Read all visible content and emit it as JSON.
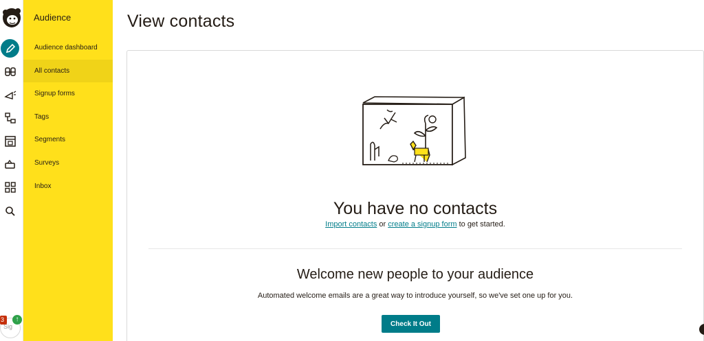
{
  "sidebar": {
    "title": "Audience",
    "items": [
      {
        "label": "Audience dashboard"
      },
      {
        "label": "All contacts"
      },
      {
        "label": "Signup forms"
      },
      {
        "label": "Tags"
      },
      {
        "label": "Segments"
      },
      {
        "label": "Surveys"
      },
      {
        "label": "Inbox"
      }
    ],
    "active_item": "All contacts"
  },
  "rail": {
    "icons": [
      "freddie-logo",
      "create-pencil-icon",
      "audience-icon",
      "campaigns-icon",
      "automations-icon",
      "website-icon",
      "content-icon",
      "integrations-grid-icon",
      "search-icon"
    ],
    "notification_count": "3",
    "avatar_text": "Sig"
  },
  "main": {
    "title": "View contacts",
    "empty_heading": "You have no contacts",
    "empty_link_import": "Import contacts",
    "empty_or": " or ",
    "empty_link_signup": "create a signup form",
    "empty_suffix": " to get started.",
    "welcome_heading": "Welcome new people to your audience",
    "welcome_sub": "Automated welcome emails are a great way to introduce yourself, so we've set one up for you.",
    "cta_label": "Check It Out"
  },
  "colors": {
    "sidebar_bg": "#ffe01b",
    "accent": "#007c89",
    "text": "#241c15"
  }
}
